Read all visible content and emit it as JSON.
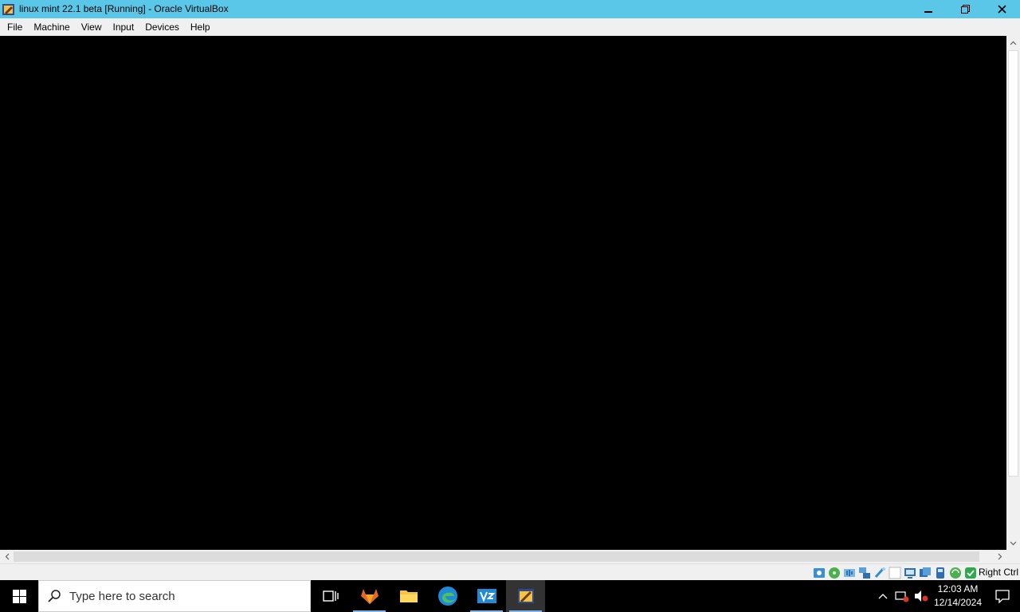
{
  "window": {
    "title": "linux mint 22.1 beta [Running] - Oracle VirtualBox",
    "controls": [
      "minimize",
      "restore",
      "close"
    ]
  },
  "menubar": {
    "items": [
      "File",
      "Machine",
      "View",
      "Input",
      "Devices",
      "Help"
    ]
  },
  "statusbar": {
    "host_key": "Right Ctrl",
    "icons": [
      "hard-disk-icon",
      "optical-drive-icon",
      "audio-icon",
      "network-icon",
      "usb-icon",
      "shared-folders-icon",
      "display-icon",
      "video-capture-icon",
      "mouse-integration-icon",
      "cpu-icon",
      "keyboard-icon",
      "settings-icon"
    ]
  },
  "taskbar": {
    "search_placeholder": "Type here to search",
    "apps": [
      "task-view",
      "gitlab",
      "file-explorer",
      "edge",
      "visual-studio",
      "virtualbox"
    ],
    "active_app": "virtualbox",
    "clock_time": "12:03 AM",
    "clock_date": "12/14/2024"
  },
  "colors": {
    "titlebar": "#5bc7e8",
    "menubar": "#f0f0f0",
    "vm_display": "#000000",
    "taskbar": "#000000"
  }
}
